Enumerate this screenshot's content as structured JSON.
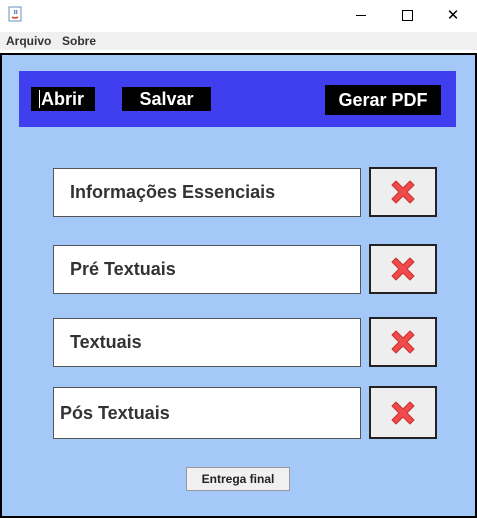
{
  "window": {
    "app_icon": "java-coffee-icon",
    "controls": {
      "minimize": "minimize-icon",
      "maximize": "maximize-icon",
      "close": "close-icon"
    }
  },
  "menu": {
    "items": [
      {
        "label": "Arquivo"
      },
      {
        "label": "Sobre"
      }
    ]
  },
  "toolbar": {
    "open_label": "Abrir",
    "save_label": "Salvar",
    "pdf_label": "Gerar PDF"
  },
  "sections": [
    {
      "label": "Informações Essenciais"
    },
    {
      "label": "Pré Textuais"
    },
    {
      "label": "Textuais"
    },
    {
      "label": "Pós Textuais"
    }
  ],
  "delete_icon": "red-x-icon",
  "final_button": {
    "label": "Entrega final"
  },
  "colors": {
    "background": "#a4c8f8",
    "toolbar": "#3f3ff0",
    "toolbar_button": "#000000",
    "delete_icon": "#f04a4a"
  }
}
